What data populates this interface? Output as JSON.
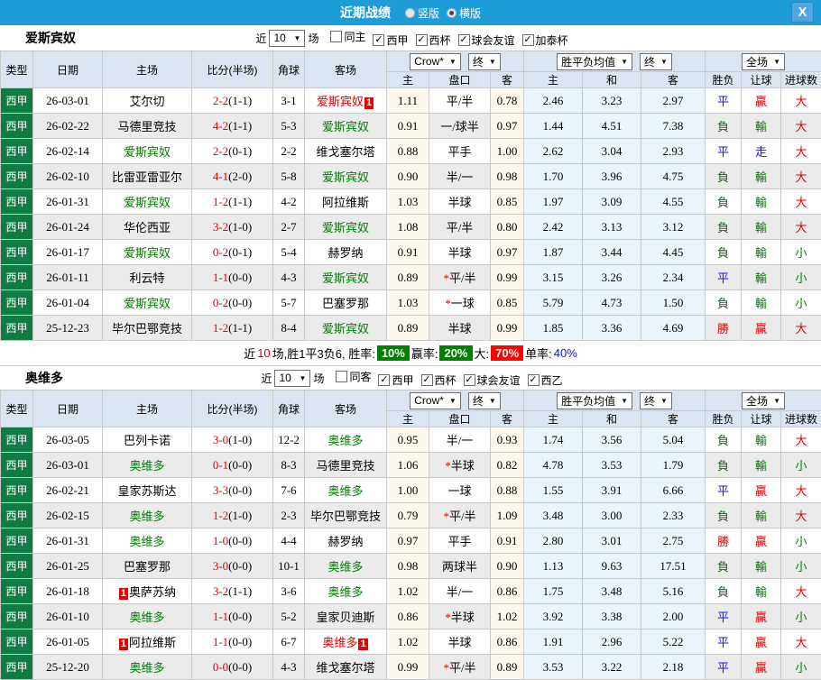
{
  "topbar": {
    "title": "近期战绩",
    "radios": [
      {
        "label": "竖版",
        "checked": false
      },
      {
        "label": "横版",
        "checked": true
      }
    ],
    "close_label": "X"
  },
  "columns": {
    "main": [
      "类型",
      "日期",
      "主场",
      "比分(半场)",
      "角球",
      "客场"
    ],
    "sub": [
      "主",
      "盘口",
      "客",
      "主",
      "和",
      "客",
      "胜负",
      "让球",
      "进球数"
    ]
  },
  "dropdowns": {
    "company": "Crow*",
    "company_final": "终",
    "wdl_avg": "胜平负均值",
    "wdl_final": "终",
    "scope": "全场"
  },
  "colors": {
    "topbar_blue": "#1e9cd7",
    "league_green": "#0f7c43",
    "win_red": "#e60000",
    "lose_green": "#008000",
    "draw_blue": "#1414e6",
    "crow_cream": "#fdf8ee",
    "avg_azure": "#eaf4fb"
  },
  "sections": [
    {
      "team": "爱斯宾奴",
      "filter": {
        "near_label": "近",
        "games": "10",
        "games_label": "场",
        "checks": [
          {
            "label": "同主",
            "checked": false
          },
          {
            "label": "西甲",
            "checked": true
          },
          {
            "label": "西杯",
            "checked": true
          },
          {
            "label": "球会友谊",
            "checked": true
          },
          {
            "label": "加泰杯",
            "checked": true
          }
        ]
      },
      "rows": [
        {
          "lg": "西甲",
          "dt": "26-03-01",
          "hm": {
            "n": "艾尔切",
            "c": "k"
          },
          "sc": "2-2",
          "hf": "(1-1)",
          "cn": "3-1",
          "aw": {
            "n": "爱斯宾奴",
            "c": "r",
            "b": "1"
          },
          "o1": "1.11",
          "st": 0,
          "hc": "平/半",
          "o2": "0.78",
          "e1": "2.46",
          "e2": "3.23",
          "e3": "2.97",
          "rs": {
            "t": "平",
            "c": "b"
          },
          "lt": {
            "t": "贏",
            "c": "r"
          },
          "gl": {
            "t": "大",
            "c": "r"
          }
        },
        {
          "lg": "西甲",
          "dt": "26-02-22",
          "hm": {
            "n": "马德里竞技",
            "c": "k"
          },
          "sc": "4-2",
          "hf": "(1-1)",
          "cn": "5-3",
          "aw": {
            "n": "爱斯宾奴",
            "c": "g"
          },
          "o1": "0.91",
          "st": 0,
          "hc": "一/球半",
          "o2": "0.97",
          "e1": "1.44",
          "e2": "4.51",
          "e3": "7.38",
          "rs": {
            "t": "負",
            "c": "g"
          },
          "lt": {
            "t": "輸",
            "c": "g"
          },
          "gl": {
            "t": "大",
            "c": "r"
          }
        },
        {
          "lg": "西甲",
          "dt": "26-02-14",
          "hm": {
            "n": "爱斯宾奴",
            "c": "g"
          },
          "sc": "2-2",
          "hf": "(0-1)",
          "cn": "2-2",
          "aw": {
            "n": "维戈塞尔塔",
            "c": "k"
          },
          "o1": "0.88",
          "st": 0,
          "hc": "平手",
          "o2": "1.00",
          "e1": "2.62",
          "e2": "3.04",
          "e3": "2.93",
          "rs": {
            "t": "平",
            "c": "b"
          },
          "lt": {
            "t": "走",
            "c": "b"
          },
          "gl": {
            "t": "大",
            "c": "r"
          }
        },
        {
          "lg": "西甲",
          "dt": "26-02-10",
          "hm": {
            "n": "比雷亚雷亚尔",
            "c": "k"
          },
          "sc": "4-1",
          "hf": "(2-0)",
          "cn": "5-8",
          "aw": {
            "n": "爱斯宾奴",
            "c": "g"
          },
          "o1": "0.90",
          "st": 0,
          "hc": "半/一",
          "o2": "0.98",
          "e1": "1.70",
          "e2": "3.96",
          "e3": "4.75",
          "rs": {
            "t": "負",
            "c": "g"
          },
          "lt": {
            "t": "輸",
            "c": "g"
          },
          "gl": {
            "t": "大",
            "c": "r"
          }
        },
        {
          "lg": "西甲",
          "dt": "26-01-31",
          "hm": {
            "n": "爱斯宾奴",
            "c": "g"
          },
          "sc": "1-2",
          "hf": "(1-1)",
          "cn": "4-2",
          "aw": {
            "n": "阿拉维斯",
            "c": "k"
          },
          "o1": "1.03",
          "st": 0,
          "hc": "半球",
          "o2": "0.85",
          "e1": "1.97",
          "e2": "3.09",
          "e3": "4.55",
          "rs": {
            "t": "負",
            "c": "g"
          },
          "lt": {
            "t": "輸",
            "c": "g"
          },
          "gl": {
            "t": "大",
            "c": "r"
          }
        },
        {
          "lg": "西甲",
          "dt": "26-01-24",
          "hm": {
            "n": "华伦西亚",
            "c": "k"
          },
          "sc": "3-2",
          "hf": "(1-0)",
          "cn": "2-7",
          "aw": {
            "n": "爱斯宾奴",
            "c": "g"
          },
          "o1": "1.08",
          "st": 0,
          "hc": "平/半",
          "o2": "0.80",
          "e1": "2.42",
          "e2": "3.13",
          "e3": "3.12",
          "rs": {
            "t": "負",
            "c": "g"
          },
          "lt": {
            "t": "輸",
            "c": "g"
          },
          "gl": {
            "t": "大",
            "c": "r"
          }
        },
        {
          "lg": "西甲",
          "dt": "26-01-17",
          "hm": {
            "n": "爱斯宾奴",
            "c": "g"
          },
          "sc": "0-2",
          "hf": "(0-1)",
          "cn": "5-4",
          "aw": {
            "n": "赫罗纳",
            "c": "k"
          },
          "o1": "0.91",
          "st": 0,
          "hc": "半球",
          "o2": "0.97",
          "e1": "1.87",
          "e2": "3.44",
          "e3": "4.45",
          "rs": {
            "t": "負",
            "c": "g"
          },
          "lt": {
            "t": "輸",
            "c": "g"
          },
          "gl": {
            "t": "小",
            "c": "g"
          }
        },
        {
          "lg": "西甲",
          "dt": "26-01-11",
          "hm": {
            "n": "利云特",
            "c": "k"
          },
          "sc": "1-1",
          "hf": "(0-0)",
          "cn": "4-3",
          "aw": {
            "n": "爱斯宾奴",
            "c": "g"
          },
          "o1": "0.89",
          "st": 1,
          "hc": "平/半",
          "o2": "0.99",
          "e1": "3.15",
          "e2": "3.26",
          "e3": "2.34",
          "rs": {
            "t": "平",
            "c": "b"
          },
          "lt": {
            "t": "輸",
            "c": "g"
          },
          "gl": {
            "t": "小",
            "c": "g"
          }
        },
        {
          "lg": "西甲",
          "dt": "26-01-04",
          "hm": {
            "n": "爱斯宾奴",
            "c": "g"
          },
          "sc": "0-2",
          "hf": "(0-0)",
          "cn": "5-7",
          "aw": {
            "n": "巴塞罗那",
            "c": "k"
          },
          "o1": "1.03",
          "st": 1,
          "hc": "一球",
          "o2": "0.85",
          "e1": "5.79",
          "e2": "4.73",
          "e3": "1.50",
          "rs": {
            "t": "負",
            "c": "g"
          },
          "lt": {
            "t": "輸",
            "c": "g"
          },
          "gl": {
            "t": "小",
            "c": "g"
          }
        },
        {
          "lg": "西甲",
          "dt": "25-12-23",
          "hm": {
            "n": "毕尔巴鄂竞技",
            "c": "k"
          },
          "sc": "1-2",
          "hf": "(1-1)",
          "cn": "8-4",
          "aw": {
            "n": "爱斯宾奴",
            "c": "g"
          },
          "o1": "0.89",
          "st": 0,
          "hc": "半球",
          "o2": "0.99",
          "e1": "1.85",
          "e2": "3.36",
          "e3": "4.69",
          "rs": {
            "t": "勝",
            "c": "r"
          },
          "lt": {
            "t": "贏",
            "c": "r"
          },
          "gl": {
            "t": "大",
            "c": "r"
          }
        }
      ],
      "summary": [
        {
          "t": "近",
          "c": "k"
        },
        {
          "t": "10",
          "c": "r"
        },
        {
          "t": "场,胜1平3负6, 胜率:",
          "c": "k"
        },
        {
          "t": "10%",
          "badge": "g"
        },
        {
          "t": "赢率:",
          "c": "k"
        },
        {
          "t": "20%",
          "badge": "g"
        },
        {
          "t": "大:",
          "c": "k"
        },
        {
          "t": "70%",
          "badge": "rd"
        },
        {
          "t": "单率:",
          "c": "k"
        },
        {
          "t": "40%",
          "c": "b"
        }
      ]
    },
    {
      "team": "奥维多",
      "filter": {
        "near_label": "近",
        "games": "10",
        "games_label": "场",
        "checks": [
          {
            "label": "同客",
            "checked": false
          },
          {
            "label": "西甲",
            "checked": true
          },
          {
            "label": "西杯",
            "checked": true
          },
          {
            "label": "球会友谊",
            "checked": true
          },
          {
            "label": "西乙",
            "checked": true
          }
        ]
      },
      "rows": [
        {
          "lg": "西甲",
          "dt": "26-03-05",
          "hm": {
            "n": "巴列卡诺",
            "c": "k"
          },
          "sc": "3-0",
          "hf": "(1-0)",
          "cn": "12-2",
          "aw": {
            "n": "奥维多",
            "c": "g"
          },
          "o1": "0.95",
          "st": 0,
          "hc": "半/一",
          "o2": "0.93",
          "e1": "1.74",
          "e2": "3.56",
          "e3": "5.04",
          "rs": {
            "t": "負",
            "c": "g"
          },
          "lt": {
            "t": "輸",
            "c": "g"
          },
          "gl": {
            "t": "大",
            "c": "r"
          }
        },
        {
          "lg": "西甲",
          "dt": "26-03-01",
          "hm": {
            "n": "奥维多",
            "c": "g"
          },
          "sc": "0-1",
          "hf": "(0-0)",
          "cn": "8-3",
          "aw": {
            "n": "马德里竞技",
            "c": "k"
          },
          "o1": "1.06",
          "st": 1,
          "hc": "半球",
          "o2": "0.82",
          "e1": "4.78",
          "e2": "3.53",
          "e3": "1.79",
          "rs": {
            "t": "負",
            "c": "g"
          },
          "lt": {
            "t": "輸",
            "c": "g"
          },
          "gl": {
            "t": "小",
            "c": "g"
          }
        },
        {
          "lg": "西甲",
          "dt": "26-02-21",
          "hm": {
            "n": "皇家苏斯达",
            "c": "k"
          },
          "sc": "3-3",
          "hf": "(0-0)",
          "cn": "7-6",
          "aw": {
            "n": "奥维多",
            "c": "g"
          },
          "o1": "1.00",
          "st": 0,
          "hc": "一球",
          "o2": "0.88",
          "e1": "1.55",
          "e2": "3.91",
          "e3": "6.66",
          "rs": {
            "t": "平",
            "c": "b"
          },
          "lt": {
            "t": "贏",
            "c": "r"
          },
          "gl": {
            "t": "大",
            "c": "r"
          }
        },
        {
          "lg": "西甲",
          "dt": "26-02-15",
          "hm": {
            "n": "奥维多",
            "c": "g"
          },
          "sc": "1-2",
          "hf": "(1-0)",
          "cn": "2-3",
          "aw": {
            "n": "毕尔巴鄂竞技",
            "c": "k"
          },
          "o1": "0.79",
          "st": 1,
          "hc": "平/半",
          "o2": "1.09",
          "e1": "3.48",
          "e2": "3.00",
          "e3": "2.33",
          "rs": {
            "t": "負",
            "c": "g"
          },
          "lt": {
            "t": "輸",
            "c": "g"
          },
          "gl": {
            "t": "大",
            "c": "r"
          }
        },
        {
          "lg": "西甲",
          "dt": "26-01-31",
          "hm": {
            "n": "奥维多",
            "c": "g"
          },
          "sc": "1-0",
          "hf": "(0-0)",
          "cn": "4-4",
          "aw": {
            "n": "赫罗纳",
            "c": "k"
          },
          "o1": "0.97",
          "st": 0,
          "hc": "平手",
          "o2": "0.91",
          "e1": "2.80",
          "e2": "3.01",
          "e3": "2.75",
          "rs": {
            "t": "勝",
            "c": "r"
          },
          "lt": {
            "t": "贏",
            "c": "r"
          },
          "gl": {
            "t": "小",
            "c": "g"
          }
        },
        {
          "lg": "西甲",
          "dt": "26-01-25",
          "hm": {
            "n": "巴塞罗那",
            "c": "k"
          },
          "sc": "3-0",
          "hf": "(0-0)",
          "cn": "10-1",
          "aw": {
            "n": "奥维多",
            "c": "g"
          },
          "o1": "0.98",
          "st": 0,
          "hc": "两球半",
          "o2": "0.90",
          "e1": "1.13",
          "e2": "9.63",
          "e3": "17.51",
          "rs": {
            "t": "負",
            "c": "g"
          },
          "lt": {
            "t": "輸",
            "c": "g"
          },
          "gl": {
            "t": "小",
            "c": "g"
          }
        },
        {
          "lg": "西甲",
          "dt": "26-01-18",
          "hm": {
            "n": "奥萨苏纳",
            "c": "k",
            "b": "1"
          },
          "sc": "3-2",
          "hf": "(1-1)",
          "cn": "3-6",
          "aw": {
            "n": "奥维多",
            "c": "g"
          },
          "o1": "1.02",
          "st": 0,
          "hc": "半/一",
          "o2": "0.86",
          "e1": "1.75",
          "e2": "3.48",
          "e3": "5.16",
          "rs": {
            "t": "負",
            "c": "g"
          },
          "lt": {
            "t": "輸",
            "c": "g"
          },
          "gl": {
            "t": "大",
            "c": "r"
          }
        },
        {
          "lg": "西甲",
          "dt": "26-01-10",
          "hm": {
            "n": "奥维多",
            "c": "g"
          },
          "sc": "1-1",
          "hf": "(0-0)",
          "cn": "5-2",
          "aw": {
            "n": "皇家贝迪斯",
            "c": "k"
          },
          "o1": "0.86",
          "st": 1,
          "hc": "半球",
          "o2": "1.02",
          "e1": "3.92",
          "e2": "3.38",
          "e3": "2.00",
          "rs": {
            "t": "平",
            "c": "b"
          },
          "lt": {
            "t": "贏",
            "c": "r"
          },
          "gl": {
            "t": "小",
            "c": "g"
          }
        },
        {
          "lg": "西甲",
          "dt": "26-01-05",
          "hm": {
            "n": "阿拉维斯",
            "c": "k",
            "b": "1"
          },
          "sc": "1-1",
          "hf": "(0-0)",
          "cn": "6-7",
          "aw": {
            "n": "奥维多",
            "c": "r",
            "b": "1"
          },
          "o1": "1.02",
          "st": 0,
          "hc": "半球",
          "o2": "0.86",
          "e1": "1.91",
          "e2": "2.96",
          "e3": "5.22",
          "rs": {
            "t": "平",
            "c": "b"
          },
          "lt": {
            "t": "贏",
            "c": "r"
          },
          "gl": {
            "t": "大",
            "c": "r"
          }
        },
        {
          "lg": "西甲",
          "dt": "25-12-20",
          "hm": {
            "n": "奥维多",
            "c": "g"
          },
          "sc": "0-0",
          "hf": "(0-0)",
          "cn": "4-3",
          "aw": {
            "n": "维戈塞尔塔",
            "c": "k"
          },
          "o1": "0.99",
          "st": 1,
          "hc": "平/半",
          "o2": "0.89",
          "e1": "3.53",
          "e2": "3.22",
          "e3": "2.18",
          "rs": {
            "t": "平",
            "c": "b"
          },
          "lt": {
            "t": "贏",
            "c": "r"
          },
          "gl": {
            "t": "小",
            "c": "g"
          }
        }
      ],
      "summary": null
    }
  ]
}
